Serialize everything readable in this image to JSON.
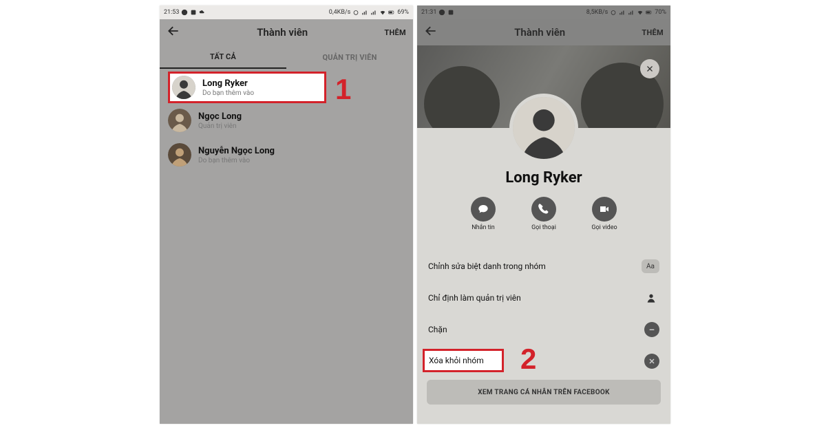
{
  "left": {
    "status": {
      "time": "21:53",
      "net": "0,4KB/s",
      "battery": "69%"
    },
    "header": {
      "title": "Thành viên",
      "more": "THÊM"
    },
    "tabs": {
      "all": "TẤT CẢ",
      "admins": "QUẢN TRỊ VIÊN"
    },
    "members": [
      {
        "name": "Long Ryker",
        "sub": "Do bạn thêm vào"
      },
      {
        "name": "Ngọc Long",
        "sub": "Quản trị viên"
      },
      {
        "name": "Nguyễn Ngọc Long",
        "sub": "Do bạn thêm vào"
      }
    ],
    "annotation_number": "1"
  },
  "right": {
    "status": {
      "time": "21:31",
      "net": "8,5KB/s",
      "battery": "70%"
    },
    "header": {
      "title": "Thành viên",
      "more": "THÊM"
    },
    "profile": {
      "name": "Long Ryker",
      "actions": {
        "message": "Nhắn tin",
        "call": "Gọi thoại",
        "video": "Gọi video"
      }
    },
    "options": {
      "nickname": "Chỉnh sửa biệt danh trong nhóm",
      "nickname_badge": "Aa",
      "make_admin": "Chỉ định làm quản trị viên",
      "block": "Chặn",
      "remove": "Xóa khỏi nhóm",
      "view_fb": "XEM TRANG CÁ NHÂN TRÊN FACEBOOK"
    },
    "annotation_number": "2"
  }
}
